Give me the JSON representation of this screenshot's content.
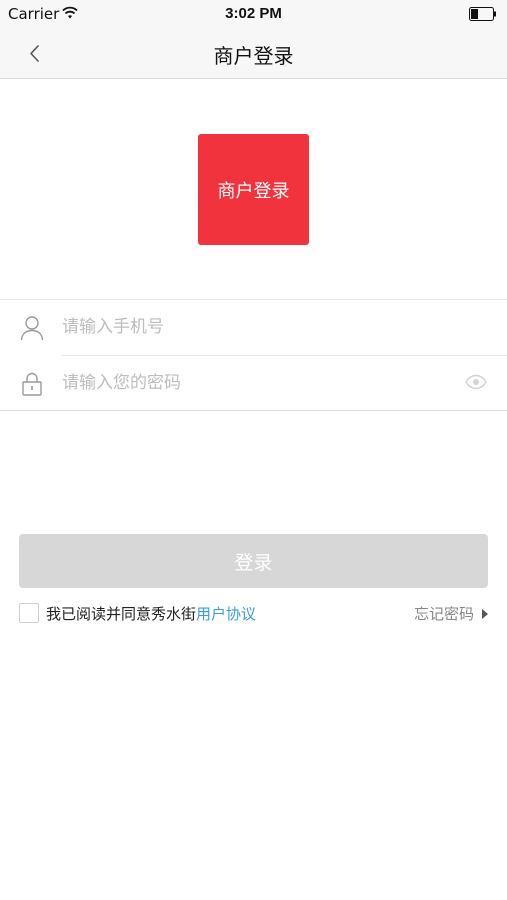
{
  "status_bar": {
    "carrier": "Carrier",
    "time": "3:02 PM",
    "icons": [
      "wifi-icon",
      "battery-icon"
    ]
  },
  "nav": {
    "back_icon": "chevron-left-icon",
    "title": "商户登录"
  },
  "logo": {
    "text": "商户登录",
    "color": "#f1333d"
  },
  "form": {
    "phone": {
      "icon": "user-icon",
      "value": "",
      "placeholder": "请输入手机号"
    },
    "password": {
      "icon": "lock-icon",
      "value": "",
      "placeholder": "请输入您的密码",
      "toggle_icon": "eye-icon"
    }
  },
  "login_button": {
    "label": "登录",
    "color": "#d7d7d7"
  },
  "agreement": {
    "checked": false,
    "text": "我已阅读并同意秀水街",
    "link_text": "用户协议",
    "link_color": "#3a9be3"
  },
  "forgot_password": {
    "label": "忘记密码",
    "icon": "caret-right-icon"
  }
}
